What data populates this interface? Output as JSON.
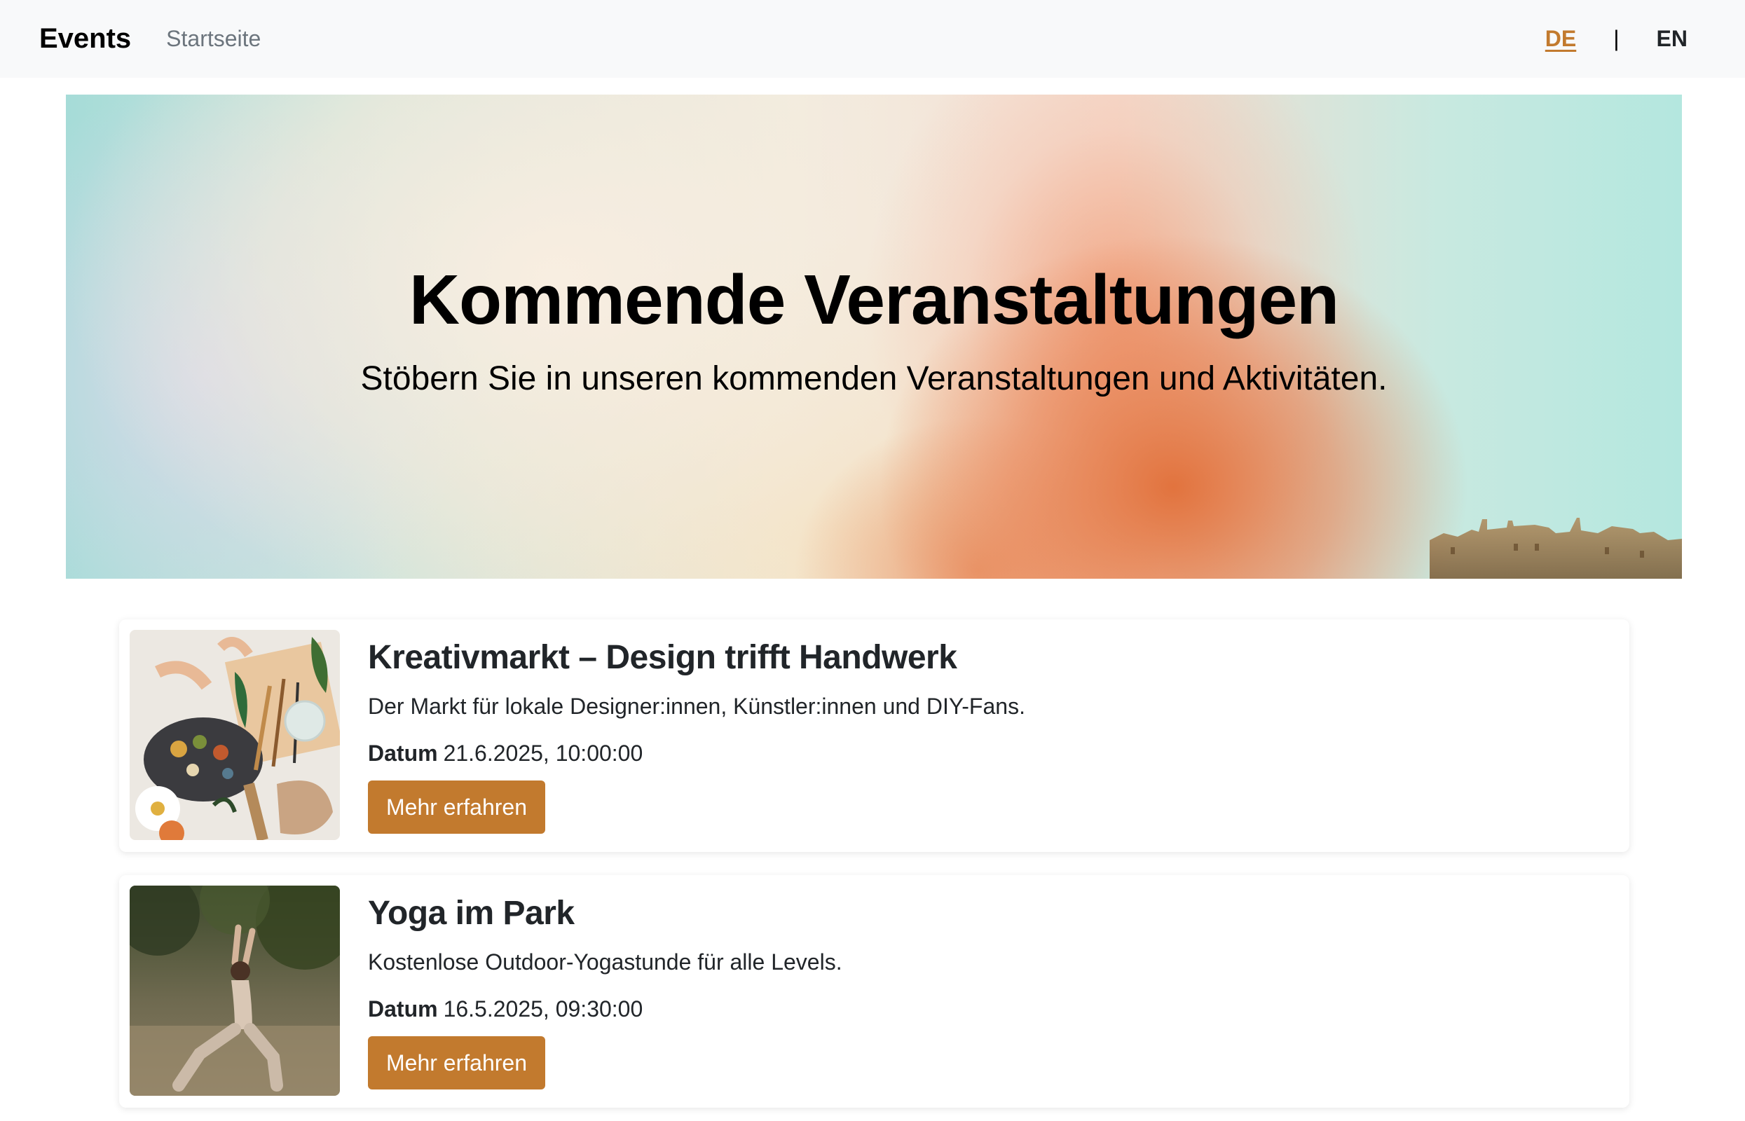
{
  "navbar": {
    "brand": "Events",
    "home_link": "Startseite",
    "lang_de": "DE",
    "lang_separator": "|",
    "lang_en": "EN"
  },
  "hero": {
    "title": "Kommende Veranstaltungen",
    "subtitle": "Stöbern Sie in unseren kommenden Veranstaltungen und Aktivitäten."
  },
  "events": [
    {
      "title": "Kreativmarkt – Design trifft Handwerk",
      "description": "Der Markt für lokale Designer:innen, Künstler:innen und DIY-Fans.",
      "date_label": "Datum",
      "date_value": "21.6.2025, 10:00:00",
      "button_label": "Mehr erfahren"
    },
    {
      "title": "Yoga im Park",
      "description": "Kostenlose Outdoor-Yogastunde für alle Levels.",
      "date_label": "Datum",
      "date_value": "16.5.2025, 09:30:00",
      "button_label": "Mehr erfahren"
    }
  ],
  "colors": {
    "accent": "#c27a2e",
    "navbar_bg": "#f8f9fa",
    "muted_text": "#6c757d"
  }
}
